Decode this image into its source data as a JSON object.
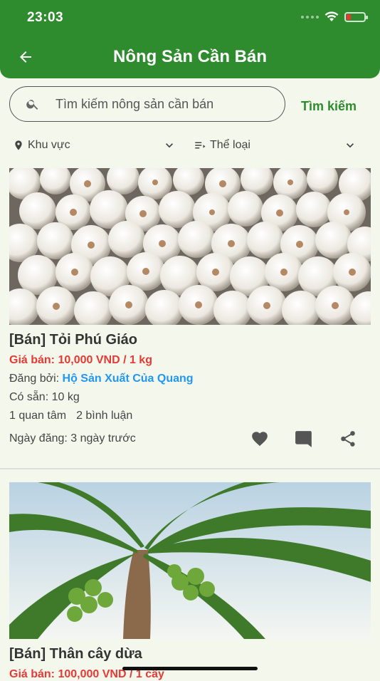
{
  "status": {
    "time": "23:03"
  },
  "header": {
    "title": "Nông Sản Cần Bán"
  },
  "search": {
    "placeholder": "Tìm kiếm nông sản cần bán",
    "button": "Tìm kiếm"
  },
  "filters": {
    "region": "Khu vực",
    "category": "Thể loại"
  },
  "labels": {
    "posted_by": "Đăng bởi: ",
    "available": "Có sẵn: ",
    "date_prefix": "Ngày đăng: "
  },
  "posts": [
    {
      "title": "[Bán] Tỏi Phú Giáo",
      "price": "Giá bán: 10,000 VND / 1 kg",
      "seller": "Hộ Sản Xuất Của Quang",
      "quantity": "10 kg",
      "interest": "1 quan tâm",
      "comments": "2 bình luận",
      "date": "3 ngày trước"
    },
    {
      "title": "[Bán] Thân cây dừa",
      "price": "Giá bán: 100,000 VND / 1 cây"
    }
  ],
  "colors": {
    "primary": "#2e8b2e",
    "price": "#e53935",
    "link": "#2196f3",
    "background": "#f4f8ec"
  },
  "icons": [
    "back-arrow-icon",
    "search-icon",
    "location-pin-icon",
    "category-icon",
    "chevron-down-icon",
    "heart-icon",
    "comment-icon",
    "share-icon",
    "wifi-icon",
    "battery-icon"
  ]
}
